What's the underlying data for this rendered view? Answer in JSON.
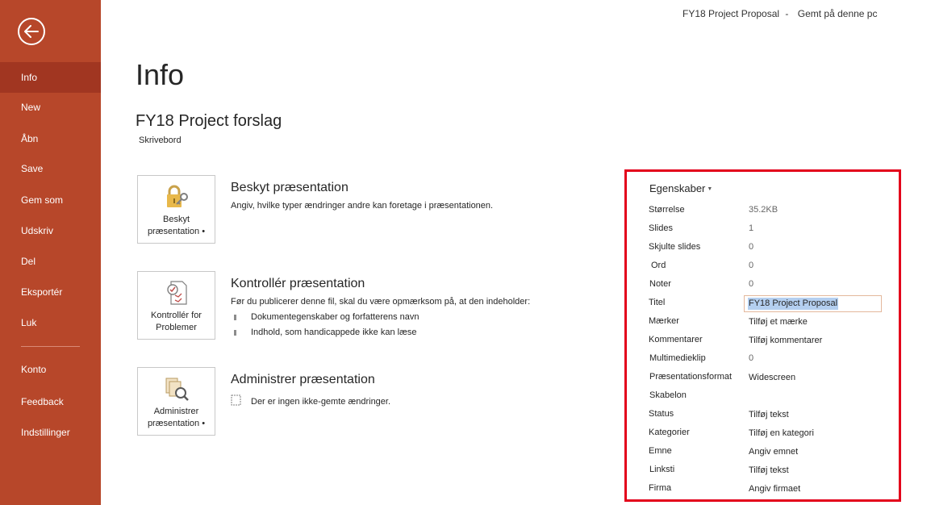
{
  "header": {
    "doc_title": "FY18 Project Proposal",
    "separator": "-",
    "save_status": "Gemt på denne pc"
  },
  "sidebar": {
    "back_icon": "back-arrow-icon",
    "items": [
      {
        "label": "Info"
      },
      {
        "label": "New"
      },
      {
        "label": "Åbn"
      },
      {
        "label": "Save"
      },
      {
        "label": "Gem som"
      },
      {
        "label": "Udskriv"
      },
      {
        "label": "Del"
      },
      {
        "label": "Eksportér"
      },
      {
        "label": "Luk"
      },
      {
        "label": "Konto"
      },
      {
        "label": "Feedback"
      },
      {
        "label": "Indstillinger"
      }
    ],
    "active_item": "Info",
    "colors": {
      "background": "#b7472a",
      "active": "#a13621"
    }
  },
  "main": {
    "page_title": "Info",
    "file_name": "FY18 Project forslag",
    "file_location": "Skrivebord",
    "sections": {
      "protect": {
        "button_label": "Beskyt præsentation •",
        "button_icon": "lock-key-icon",
        "title": "Beskyt præsentation",
        "description": "Angiv, hvilke typer ændringer andre kan foretage i præsentationen."
      },
      "inspect": {
        "button_label": "Kontrollér for Problemer",
        "button_icon": "checklist-icon",
        "title": "Kontrollér præsentation",
        "description": "Før du publicerer denne fil, skal du være opmærksom på, at den indeholder:",
        "bullets": [
          "Dokumentegenskaber og forfatterens navn",
          "Indhold, som handicappede ikke kan læse"
        ]
      },
      "manage": {
        "button_label": "Administrer præsentation •",
        "button_icon": "manage-versions-icon",
        "title": "Administrer præsentation",
        "note": "Der er ingen ikke-gemte ændringer.",
        "note_icon": "document-icon"
      }
    }
  },
  "properties": {
    "header": "Egenskaber",
    "highlight_color": "#e3001b",
    "rows": [
      {
        "label": "Størrelse",
        "value": "35.2KB"
      },
      {
        "label": "Slides",
        "value": "1"
      },
      {
        "label": "Skjulte slides",
        "value": "0"
      },
      {
        "label": "Ord",
        "value": "0"
      },
      {
        "label": "Noter",
        "value": "0"
      },
      {
        "label": "Titel",
        "value": "FY18 Project Proposal"
      },
      {
        "label": "Mærker",
        "value": "Tilføj et mærke"
      },
      {
        "label": "Kommentarer",
        "value": "Tilføj kommentarer"
      },
      {
        "label": "Multimedieklip",
        "value": "0"
      },
      {
        "label": "Præsentationsformat",
        "value": "Widescreen"
      },
      {
        "label": "Skabelon",
        "value": ""
      },
      {
        "label": "Status",
        "value": "Tilføj tekst"
      },
      {
        "label": "Kategorier",
        "value": "Tilføj en kategori"
      },
      {
        "label": "Emne",
        "value": "Angiv emnet"
      },
      {
        "label": "Linksti",
        "value": "Tilføj tekst"
      },
      {
        "label": "Firma",
        "value": "Angiv firmaet"
      }
    ]
  }
}
